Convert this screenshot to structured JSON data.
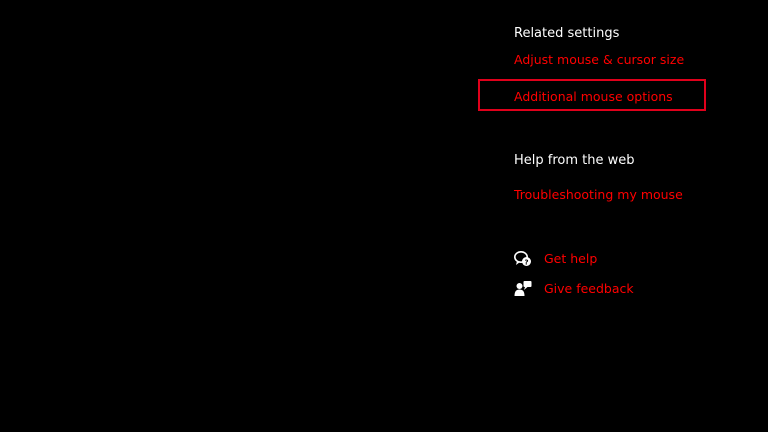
{
  "related_settings": {
    "heading": "Related settings",
    "links": [
      {
        "label": "Adjust mouse & cursor size"
      },
      {
        "label": "Additional mouse options"
      }
    ]
  },
  "help_from_web": {
    "heading": "Help from the web",
    "links": [
      {
        "label": "Troubleshooting my mouse"
      }
    ]
  },
  "support": {
    "get_help": {
      "label": "Get help",
      "icon": "get-help-icon"
    },
    "give_feedback": {
      "label": "Give feedback",
      "icon": "give-feedback-icon"
    }
  },
  "colors": {
    "background": "#000000",
    "heading": "#ffffff",
    "link": "#ff0000",
    "highlight": "#e0001b"
  }
}
